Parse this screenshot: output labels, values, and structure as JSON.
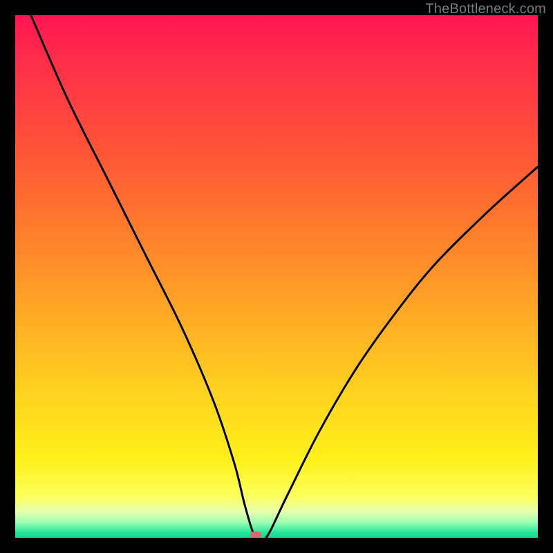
{
  "attribution": "TheBottleneck.com",
  "colors": {
    "frame": "#000000",
    "curve": "#000000",
    "marker": "#d46a6a",
    "gradient_top": "#ff1452",
    "gradient_bottom": "#11d990"
  },
  "chart_data": {
    "type": "line",
    "title": "",
    "xlabel": "",
    "ylabel": "",
    "xlim": [
      0,
      100
    ],
    "ylim": [
      0,
      100
    ],
    "grid": false,
    "legend": false,
    "annotations": [
      {
        "kind": "marker",
        "x": 46,
        "y": 0,
        "shape": "pill",
        "color": "#d46a6a"
      }
    ],
    "series": [
      {
        "name": "bottleneck-curve",
        "color": "#000000",
        "x": [
          3,
          10,
          18,
          25,
          32,
          38,
          42,
          44,
          46,
          48,
          52,
          58,
          65,
          72,
          80,
          90,
          100
        ],
        "y": [
          100,
          84,
          68,
          54,
          40,
          26,
          14,
          6,
          0,
          0,
          8,
          20,
          32,
          42,
          52,
          62,
          71
        ]
      }
    ],
    "note": "y is expressed as percent of plot height from bottom (0 = bottom/green, 100 = top/red). Values estimated from pixel positions; no numeric axes shown."
  }
}
